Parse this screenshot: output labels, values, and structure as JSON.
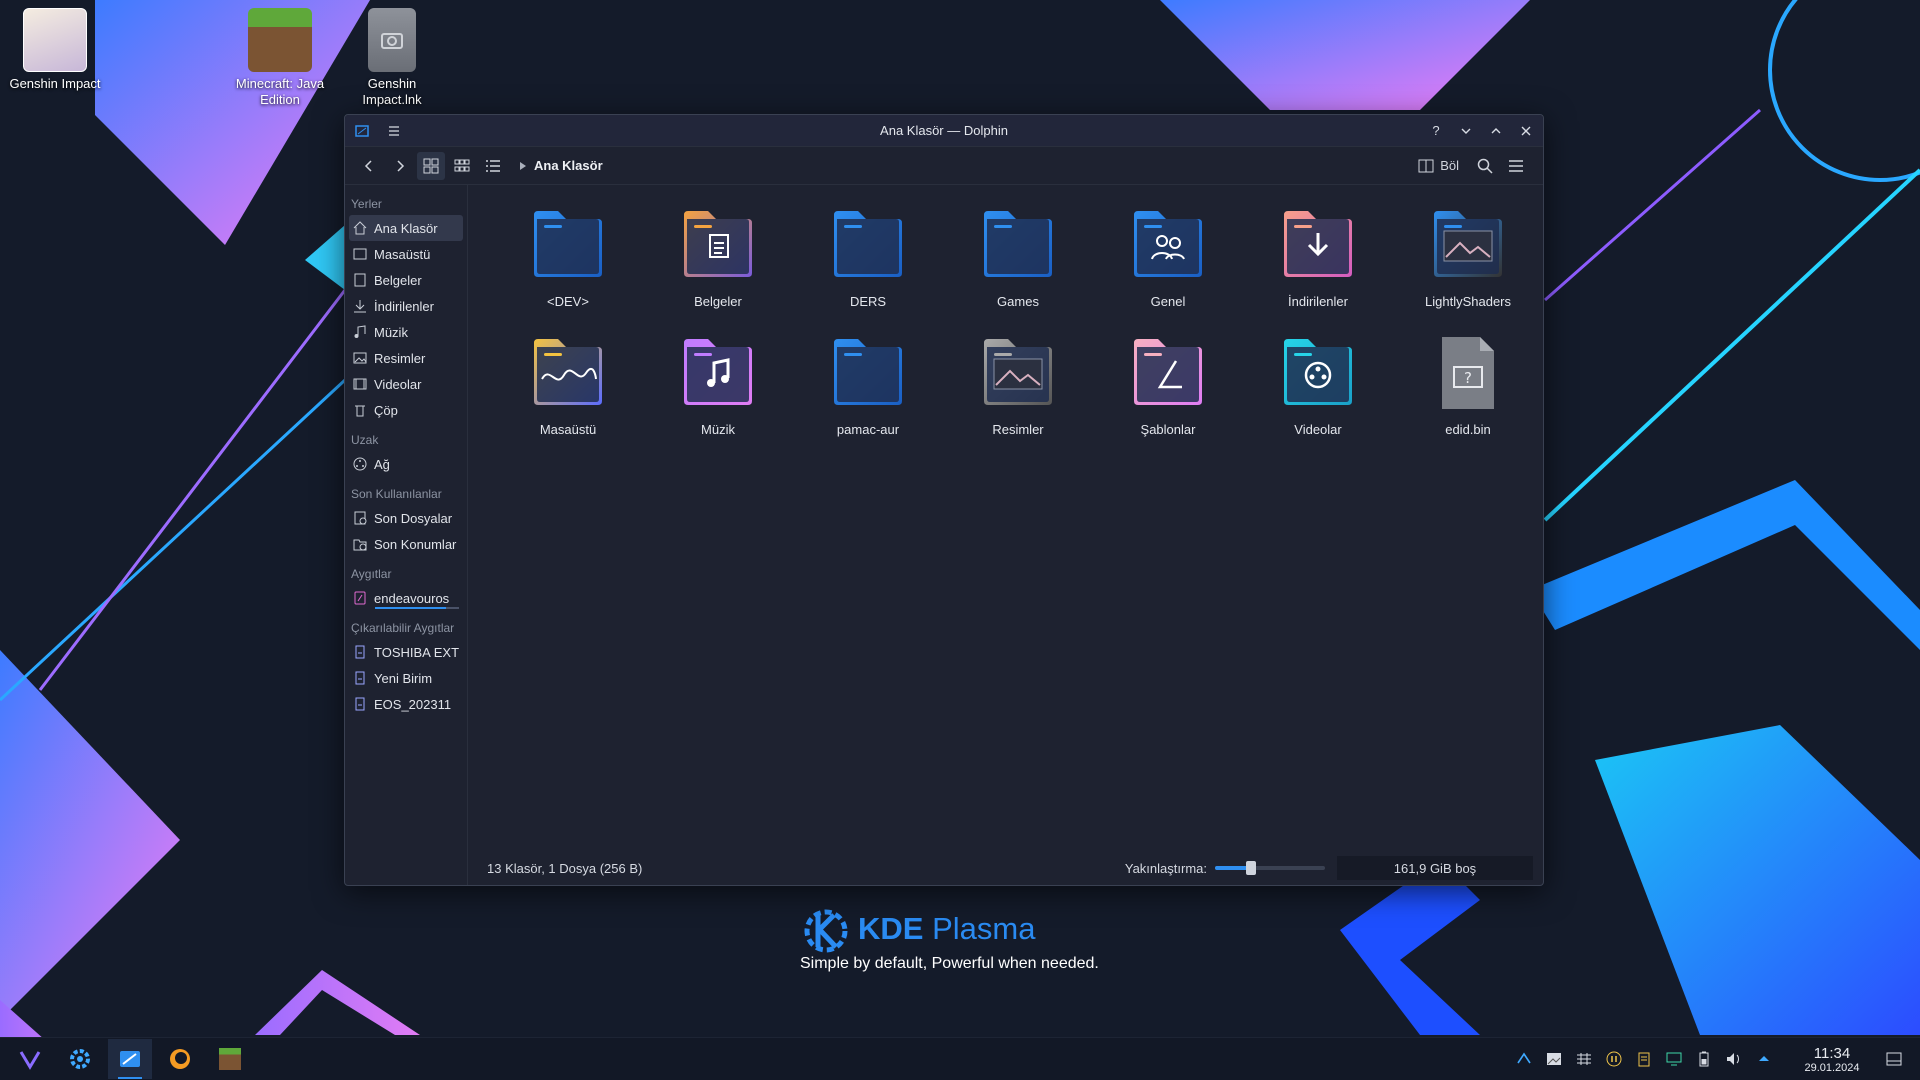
{
  "colors": {
    "accent": "#2f8ff0",
    "window_bg": "#1e2230",
    "desktop_bg": "#141b2a"
  },
  "desktop": {
    "icons": [
      {
        "label": "Genshin Impact",
        "icon": "genshin-app-icon"
      },
      {
        "label": "Minecraft: Java Edition",
        "icon": "minecraft-grass-icon"
      },
      {
        "label": "Genshin Impact.lnk",
        "icon": "shortcut-file-icon"
      }
    ],
    "kde": {
      "brand": "KDE",
      "product": "Plasma",
      "tagline": "Simple by default, Powerful when needed."
    }
  },
  "window": {
    "title": "Ana Klasör — Dolphin",
    "breadcrumb": "Ana Klasör",
    "split_label": "Böl",
    "sidebar": {
      "places_title": "Yerler",
      "places": [
        "Ana Klasör",
        "Masaüstü",
        "Belgeler",
        "İndirilenler",
        "Müzik",
        "Resimler",
        "Videolar",
        "Çöp"
      ],
      "remote_title": "Uzak",
      "remote": [
        "Ağ"
      ],
      "recent_title": "Son Kullanılanlar",
      "recent": [
        "Son Dosyalar",
        "Son Konumlar"
      ],
      "devices_title": "Aygıtlar",
      "devices": [
        "endeavouros"
      ],
      "device_usage_fraction": 0.85,
      "removable_title": "Çıkarılabilir Aygıtlar",
      "removable": [
        "TOSHIBA EXT",
        "Yeni Birim",
        "EOS_202311"
      ]
    },
    "files": [
      {
        "name": "<DEV>",
        "icon": "folder-icon"
      },
      {
        "name": "Belgeler",
        "icon": "folder-documents-icon"
      },
      {
        "name": "DERS",
        "icon": "folder-icon"
      },
      {
        "name": "Games",
        "icon": "folder-icon"
      },
      {
        "name": "Genel",
        "icon": "folder-public-icon"
      },
      {
        "name": "İndirilenler",
        "icon": "folder-download-icon"
      },
      {
        "name": "LightlyShaders",
        "icon": "folder-preview-icon"
      },
      {
        "name": "Masaüstü",
        "icon": "folder-desktop-icon"
      },
      {
        "name": "Müzik",
        "icon": "folder-music-icon"
      },
      {
        "name": "pamac-aur",
        "icon": "folder-icon"
      },
      {
        "name": "Resimler",
        "icon": "folder-pictures-icon"
      },
      {
        "name": "Şablonlar",
        "icon": "folder-templates-icon"
      },
      {
        "name": "Videolar",
        "icon": "folder-videos-icon"
      },
      {
        "name": "edid.bin",
        "icon": "unknown-file-icon"
      }
    ],
    "status": {
      "summary": "13 Klasör, 1 Dosya (256 B)",
      "zoom_label": "Yakınlaştırma:",
      "zoom_fraction": 0.33,
      "free_space": "161,9 GiB boş"
    }
  },
  "taskbar": {
    "apps": [
      "app-launcher-icon",
      "system-settings-icon",
      "dolphin-icon",
      "firefox-icon",
      "minecraft-icon"
    ],
    "time": "11:34",
    "date": "29.01.2024"
  }
}
